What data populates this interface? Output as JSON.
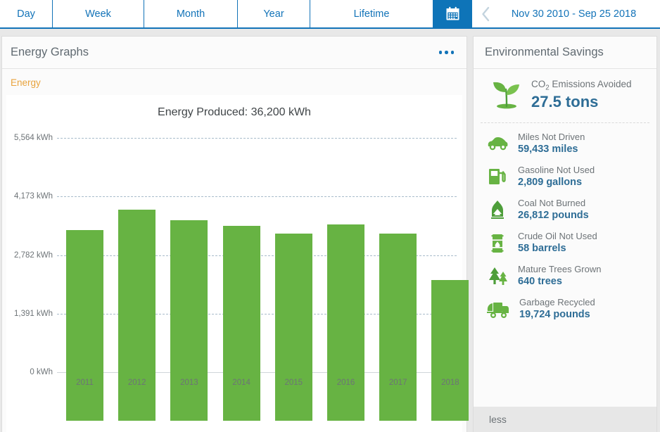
{
  "tabs": [
    {
      "label": "Day",
      "name": "tab-day"
    },
    {
      "label": "Week",
      "name": "tab-week"
    },
    {
      "label": "Month",
      "name": "tab-month"
    },
    {
      "label": "Year",
      "name": "tab-year"
    },
    {
      "label": "Lifetime",
      "name": "tab-lifetime"
    }
  ],
  "toolbar": {
    "calendar_icon": "calendar-icon",
    "prev_icon": "chevron-left-icon",
    "date_range": "Nov 30 2010 - Sep 25 2018"
  },
  "left_panel": {
    "title": "Energy Graphs",
    "menu_icon": "more-options-icon",
    "series_label": "Energy"
  },
  "chart_data": {
    "type": "bar",
    "title": "Energy Produced: 36,200 kWh",
    "xlabel": "",
    "ylabel": "kWh",
    "categories": [
      "2011",
      "2012",
      "2013",
      "2014",
      "2015",
      "2016",
      "2017",
      "2018"
    ],
    "values": [
      4528,
      5013,
      4762,
      4628,
      4444,
      4662,
      4444,
      3341
    ],
    "ylim": [
      0,
      5564
    ],
    "yticks": [
      0,
      1391,
      2782,
      4173,
      5564
    ],
    "ytick_labels": [
      "0 kWh",
      "1,391 kWh",
      "2,782 kWh",
      "4,173 kWh",
      "5,564 kWh"
    ],
    "series_name": "Energy",
    "bar_color": "#67b343",
    "grid": true,
    "legend": "none",
    "total_label": "Energy Produced",
    "total_value": "36,200 kWh"
  },
  "right_panel": {
    "title": "Environmental Savings",
    "hero": {
      "icon": "sprout-icon",
      "label_prefix": "CO",
      "label_sub": "2",
      "label_suffix": " Emissions Avoided",
      "value": "27.5 tons"
    },
    "stats": [
      {
        "icon": "car-icon",
        "label": "Miles Not Driven",
        "value": "59,433 miles"
      },
      {
        "icon": "fuel-pump-icon",
        "label": "Gasoline Not Used",
        "value": "2,809 gallons"
      },
      {
        "icon": "coal-furnace-icon",
        "label": "Coal Not Burned",
        "value": "26,812 pounds"
      },
      {
        "icon": "oil-barrel-icon",
        "label": "Crude Oil Not Used",
        "value": "58 barrels"
      },
      {
        "icon": "trees-icon",
        "label": "Mature Trees Grown",
        "value": "640 trees"
      },
      {
        "icon": "garbage-truck-icon",
        "label": "Garbage Recycled",
        "value": "19,724 pounds"
      }
    ],
    "footer_link": "less"
  },
  "colors": {
    "accent_blue": "#1273b8",
    "bar_green": "#67b343",
    "value_blue": "#2e6d96",
    "series_orange": "#e8a33d"
  }
}
